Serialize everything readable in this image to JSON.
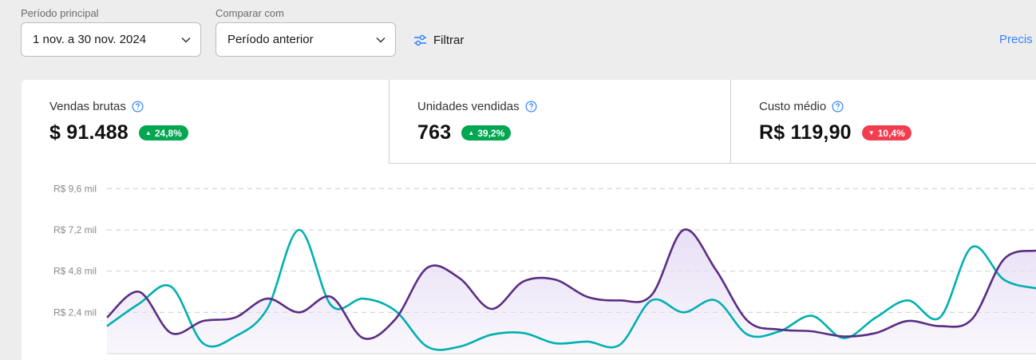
{
  "filters": {
    "main_period": {
      "label": "Período principal",
      "value": "1 nov. a 30 nov. 2024"
    },
    "compare": {
      "label": "Comparar com",
      "value": "Período anterior"
    },
    "filter_label": "Filtrar",
    "help_link": "Precis"
  },
  "metrics": [
    {
      "title": "Vendas brutas",
      "value": "$ 91.488",
      "change": "24,8%",
      "direction": "up",
      "badge_color": "#00a650"
    },
    {
      "title": "Unidades vendidas",
      "value": "763",
      "change": "39,2%",
      "direction": "up",
      "badge_color": "#00a650"
    },
    {
      "title": "Custo médio",
      "value": "R$ 119,90",
      "change": "10,4%",
      "direction": "down",
      "badge_color": "#f23d4f"
    }
  ],
  "colors": {
    "current_series": "#5a2d82",
    "previous_series": "#00b0b0",
    "area_fill": "#e8dff5",
    "accent_link": "#3483fa"
  },
  "chart_data": {
    "type": "area",
    "y_tick_labels": [
      "R$ 2,4 mil",
      "R$ 4,8 mil",
      "R$ 7,2 mil",
      "R$ 9,6 mil"
    ],
    "y_ticks": [
      2.4,
      4.8,
      7.2,
      9.6
    ],
    "ylim": [
      0,
      10.5
    ],
    "grid": true,
    "legend": "none",
    "series": [
      {
        "values": [
          2.1,
          3.6,
          1.2,
          1.9,
          2.1,
          3.2,
          2.4,
          3.3,
          0.9,
          2.0,
          5.0,
          4.4,
          2.6,
          4.2,
          4.3,
          3.3,
          3.1,
          3.4,
          7.2,
          4.9,
          1.9,
          1.4,
          1.3,
          1.0,
          1.2,
          1.9,
          1.6,
          2.0,
          5.5,
          6.0
        ]
      },
      {
        "values": [
          1.6,
          2.9,
          3.9,
          0.6,
          1.0,
          2.6,
          7.2,
          2.8,
          3.2,
          2.5,
          0.4,
          0.4,
          1.1,
          1.2,
          0.6,
          0.7,
          0.5,
          3.1,
          2.4,
          3.1,
          1.1,
          1.3,
          2.2,
          0.9,
          2.1,
          3.1,
          2.1,
          6.2,
          4.3,
          3.8
        ]
      }
    ]
  }
}
